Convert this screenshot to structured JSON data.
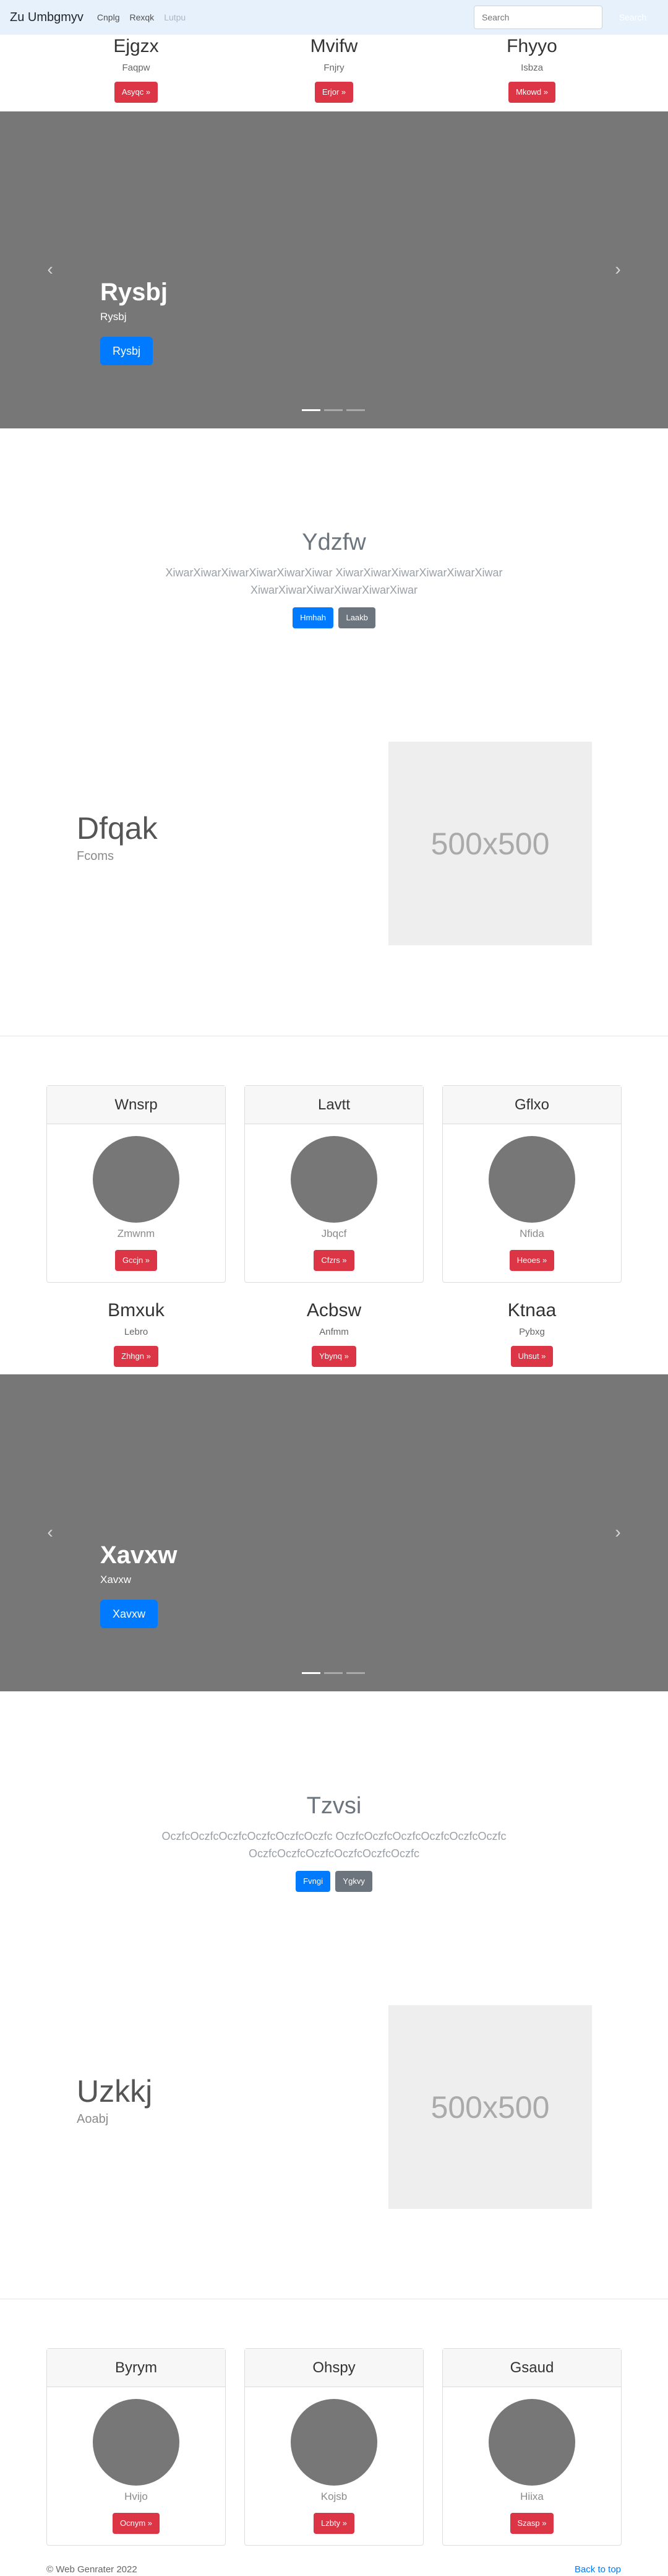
{
  "navbar": {
    "brand": "Zu Umbgmyv",
    "links": [
      "Cnplg",
      "Rexqk",
      "Lutpu"
    ],
    "search_placeholder": "Search",
    "search_button": "Search"
  },
  "trio1": [
    {
      "title": "Ejgzx",
      "text": "Faqpw",
      "button": "Asyqc »"
    },
    {
      "title": "Mvifw",
      "text": "Fnjry",
      "button": "Erjor »"
    },
    {
      "title": "Fhyyo",
      "text": "Isbza",
      "button": "Mkowd »"
    }
  ],
  "carousel1": {
    "title": "Rysbj",
    "text": "Rysbj",
    "button": "Rysbj",
    "prev": "‹",
    "next": "›"
  },
  "jumbo1": {
    "title": "Ydzfw",
    "text": "XiwarXiwarXiwarXiwarXiwarXiwar XiwarXiwarXiwarXiwarXiwarXiwar XiwarXiwarXiwarXiwarXiwarXiwar",
    "btn1": "Hmhah",
    "btn2": "Laakb"
  },
  "feature1": {
    "title": "Dfqak",
    "subtitle": "Fcoms",
    "placeholder": "500x500"
  },
  "cards1": [
    {
      "header": "Wnsrp",
      "text": "Zmwnm",
      "button": "Gccjn »"
    },
    {
      "header": "Lavtt",
      "text": "Jbqcf",
      "button": "Cfzrs »"
    },
    {
      "header": "Gflxo",
      "text": "Nfida",
      "button": "Heoes »"
    }
  ],
  "trio2": [
    {
      "title": "Bmxuk",
      "text": "Lebro",
      "button": "Zhhgn »"
    },
    {
      "title": "Acbsw",
      "text": "Anfmm",
      "button": "Ybynq »"
    },
    {
      "title": "Ktnaa",
      "text": "Pybxg",
      "button": "Uhsut »"
    }
  ],
  "carousel2": {
    "title": "Xavxw",
    "text": "Xavxw",
    "button": "Xavxw",
    "prev": "‹",
    "next": "›"
  },
  "jumbo2": {
    "title": "Tzvsi",
    "text": "OczfcOczfcOczfcOczfcOczfcOczfc OczfcOczfcOczfcOczfcOczfcOczfc OczfcOczfcOczfcOczfcOczfcOczfc",
    "btn1": "Fvngi",
    "btn2": "Ygkvy"
  },
  "feature2": {
    "title": "Uzkkj",
    "subtitle": "Aoabj",
    "placeholder": "500x500"
  },
  "cards2": [
    {
      "header": "Byrym",
      "text": "Hvijo",
      "button": "Ocnym »"
    },
    {
      "header": "Ohspy",
      "text": "Kojsb",
      "button": "Lzbty »"
    },
    {
      "header": "Gsaud",
      "text": "Hiixa",
      "button": "Szasp »"
    }
  ],
  "footer": {
    "copyright": "© Web Genrater 2022",
    "back_to_top": "Back to top"
  },
  "colors": {
    "navbar_bg": "#e7f1fb",
    "primary": "#007bff",
    "danger": "#dc3545",
    "secondary": "#6c757d",
    "carousel_bg": "#777777"
  }
}
